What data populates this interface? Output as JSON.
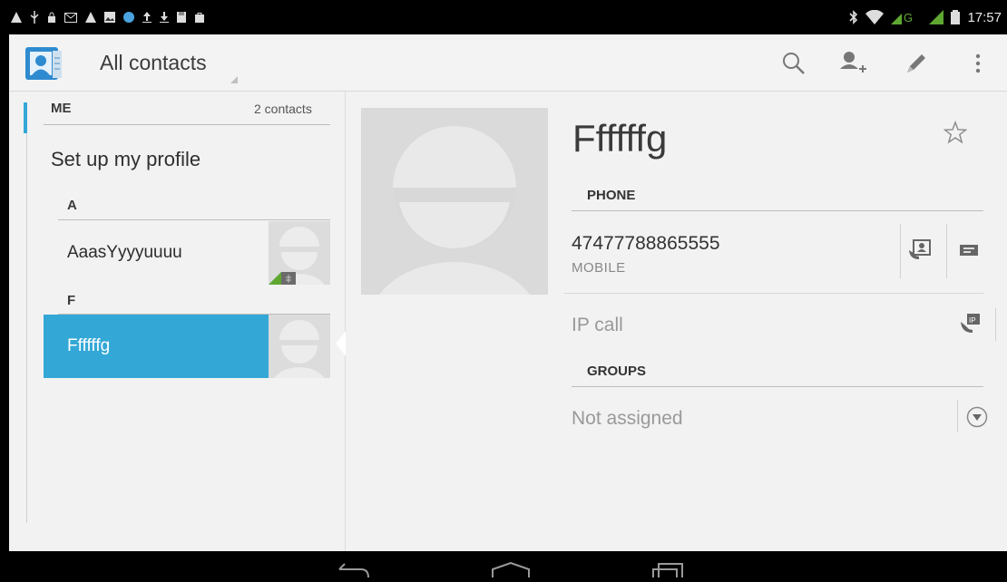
{
  "status": {
    "clock": "17:57",
    "network": "G"
  },
  "action_bar": {
    "title": "All contacts",
    "icons": [
      "contacts-app-icon",
      "search-icon",
      "add-contact-icon",
      "edit-icon",
      "overflow-menu-icon"
    ]
  },
  "list": {
    "me_header": "ME",
    "contact_count": "2 contacts",
    "setup_profile": "Set up my profile",
    "sections": [
      {
        "letter": "A",
        "contact": "AaasYyyyuuuu"
      },
      {
        "letter": "F",
        "contact": "Ffffffg"
      }
    ]
  },
  "detail": {
    "name": "Ffffffg",
    "phone_header": "PHONE",
    "phone_number": "47477788865555",
    "phone_type": "MOBILE",
    "ip_call": "IP call",
    "groups_header": "GROUPS",
    "groups_value": "Not assigned"
  },
  "colors": {
    "accent": "#33a8d6",
    "background": "#f2f2f2",
    "placeholder": "#dcdcdc"
  }
}
